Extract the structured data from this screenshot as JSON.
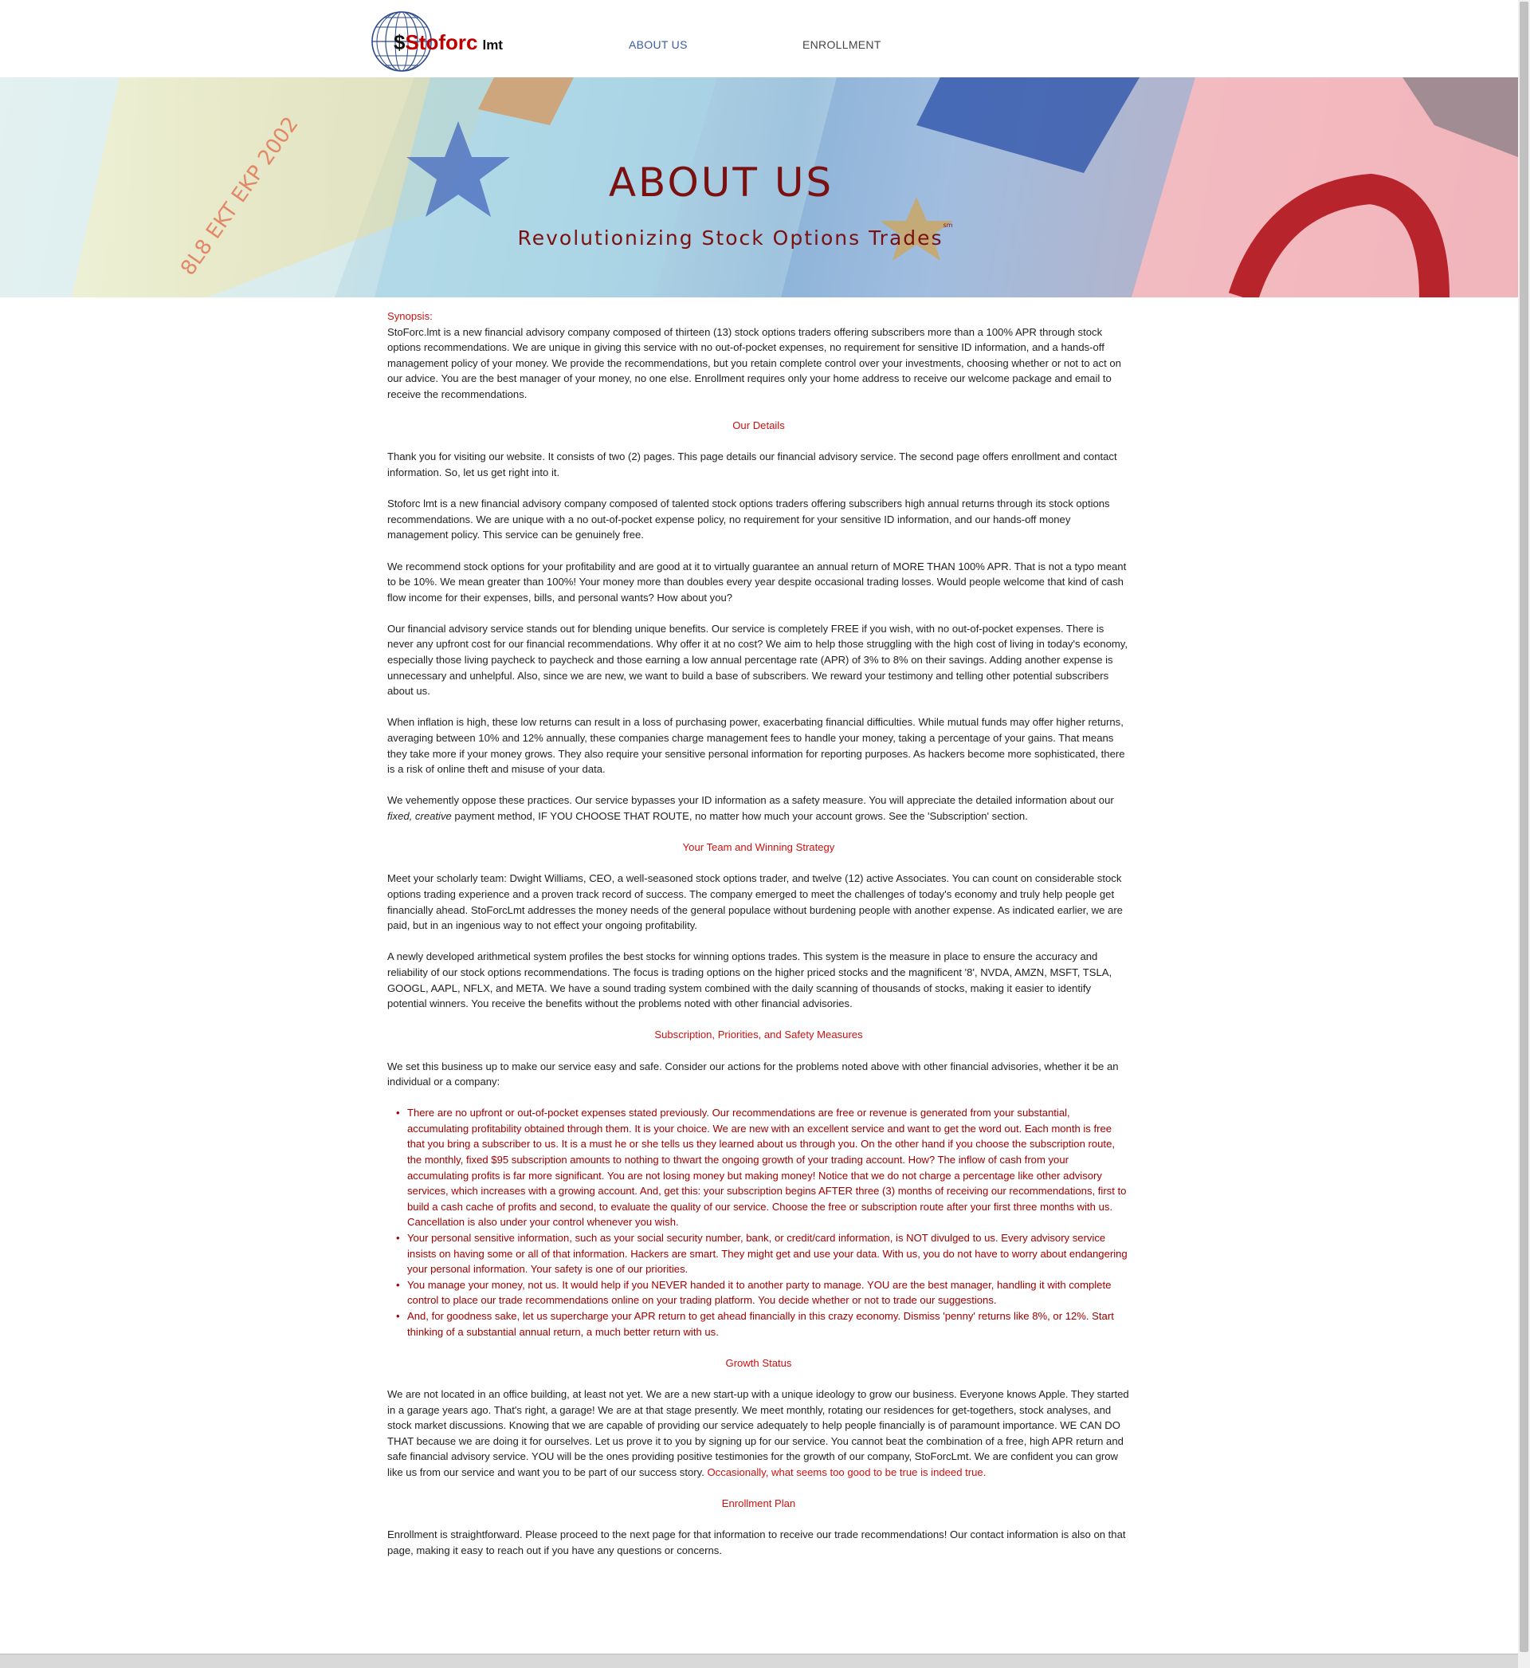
{
  "header": {
    "logo": {
      "dollar": "$",
      "brand": "Stoforc",
      "suffix": "lmt"
    },
    "nav": {
      "about": "ABOUT US",
      "enrollment": "ENROLLMENT"
    }
  },
  "banner": {
    "title": "ABOUT US",
    "subtitle": "Revolutionizing Stock Options Trades",
    "subtitle_mark": "sm"
  },
  "content": {
    "synopsis_label": "Synopsis:",
    "synopsis": "StoForc.lmt is a new financial advisory company composed of thirteen (13) stock options traders offering subscribers more than a 100% APR through stock options recommendations.  We are unique in giving this service with no out-of-pocket expenses, no requirement for sensitive ID information, and a hands-off management policy of your money. We provide the recommendations, but you retain complete control over your investments, choosing whether or not to act on our advice. You are the best manager of your money, no one else. Enrollment requires only your home address to receive our welcome package and email to receive the recommendations.",
    "details_heading": "Our Details",
    "details_p1": "Thank you for visiting our website. It consists of two (2) pages. This page details our financial advisory service. The second page offers enrollment and contact information. So, let us get right into it.",
    "details_p2": "Stoforc lmt is a new financial advisory company composed of talented stock options traders offering subscribers high annual returns through its stock options recommendations.  We are unique with a no out-of-pocket expense policy, no requirement for your sensitive ID information, and our hands-off money management policy. This service can be genuinely free.",
    "details_p3": "We recommend stock options for your profitability and are good at it to virtually guarantee an annual return of MORE THAN 100% APR. That is not a typo meant to be 10%. We mean greater than 100%! Your money more than doubles every year despite occasional trading losses. Would people welcome that kind of cash flow income for their expenses, bills, and personal wants? How about you?",
    "details_p4": "Our financial advisory service stands out for blending unique benefits. Our service is completely FREE if you wish, with no out-of-pocket expenses. There is never any upfront cost for our financial recommendations. Why offer it at no cost? We aim to help those struggling with the high cost of living in today's economy, especially those living paycheck to paycheck and those earning a low annual percentage rate (APR) of 3% to 8% on their savings. Adding another expense is unnecessary and unhelpful. Also, since we are new, we want to build a base of subscribers. We reward your testimony and telling other potential subscribers about us.",
    "details_p5": "When inflation is high, these low returns can result in a loss of purchasing power, exacerbating financial difficulties. While mutual funds may offer higher returns, averaging between 10% and 12% annually, these companies charge management fees to handle your money, taking a percentage of your gains. That means they take more if your money grows. They also require your sensitive personal information for reporting purposes. As hackers become more sophisticated, there is a risk of online theft and misuse of your data.",
    "details_p6_a": "We vehemently oppose these practices. Our service bypasses your ID information as a safety measure. You will appreciate the detailed information about our ",
    "details_p6_fixed": "fixed, creative",
    "details_p6_b": " payment method, IF YOU CHOOSE THAT ROUTE, no matter how much your account grows. See the 'Subscription' section.",
    "team_heading": "Your Team and Winning Strategy",
    "team_p1": "Meet your scholarly team: Dwight Williams, CEO, a well-seasoned stock options trader, and twelve (12) active Associates. You can count on considerable stock options trading experience and a proven track record of success. The company emerged to meet the challenges of today's economy and truly help people get financially ahead. StoForcLmt addresses the money needs of the general populace without burdening people with another expense. As indicated earlier, we are paid, but in an ingenious way to not effect your ongoing profitability.",
    "team_p2": "A newly developed arithmetical system profiles the best stocks for winning options trades. This system is the measure in place to ensure the accuracy and reliability of our stock options recommendations. The focus is trading options on the higher priced stocks and the magnificent '8', NVDA, AMZN, MSFT, TSLA, GOOGL, AAPL, NFLX, and META. We have a sound trading system combined with the daily scanning of thousands of stocks, making it easier to identify potential winners. You receive the benefits without the problems noted with other financial advisories.",
    "subs_heading": "Subscription, Priorities, and Safety Measures",
    "subs_p1": "We set this business up to make our service easy and safe. Consider our actions for the problems noted above with other financial advisories, whether it be an individual or a company:",
    "bullets": [
      "There are no upfront or out-of-pocket expenses stated previously. Our  recommendations are free or revenue is generated from your substantial, accumulating profitability obtained through them. It is your choice. We are new with an excellent service and want to get the word out. Each month is free that you bring a subscriber to us. It is a must he or she tells us they learned about us through you. On the other hand if you choose the subscription route, the monthly, fixed $95 subscription amounts to nothing to thwart the ongoing growth of your trading account. How? The inflow of cash from your accumulating profits is far more significant. You are not losing money but making money! Notice that we do not charge a percentage like other advisory services, which increases with a growing account. And, get this: your subscription begins AFTER three (3) months of receiving our recommendations, first to build a cash cache of profits and second, to evaluate the quality of our service. Choose the free or subscription route after your first three months with us. Cancellation is also under your control whenever you wish.",
      "Your personal sensitive information, such as your social security number, bank, or credit/card information, is NOT divulged to us. Every advisory service insists on having some or all of that information. Hackers are smart. They might get and use your data. With us, you do not have to worry about endangering your personal information. Your safety is one of our priorities.",
      "You manage your money, not us. It would help if you NEVER handed it to another party to manage. YOU are the best manager, handling it with complete control to place our trade recommendations online on your trading platform. You decide whether or not to trade our suggestions.",
      "And, for goodness sake, let us supercharge your APR return to get ahead financially in this crazy economy.  Dismiss 'penny' returns like 8%, or 12%. Start thinking of a substantial annual return, a much better return with us."
    ],
    "growth_heading": "Growth Status",
    "growth_p1_a": "We are not located in an office building, at least not yet. We are a new start-up with a unique ideology to grow our business. Everyone knows Apple. They started in a garage years ago. That's right, a garage! We are at that stage presently. We meet monthly, rotating our residences for get-togethers, stock analyses, and stock market discussions. Knowing that we are capable of providing our service adequately to help people financially is of paramount importance.  WE CAN DO THAT because we are doing it for ourselves. Let us prove it to you by signing up for our service. You cannot beat the combination of a free, high APR return and safe financial advisory service. YOU will be the ones providing positive testimonies for the growth of our company, StoForcLmt. We are confident you can grow like us from our service and want you to be part of our success story. ",
    "growth_p1_red": "Occasionally, what seems too good to be true is indeed true.",
    "enroll_heading": "Enrollment Plan",
    "enroll_p1": "Enrollment is straightforward. Please proceed to the next page for that information to receive our trade recommendations! Our contact information is also on that page, making it easy to reach out if you have any questions or concerns."
  },
  "colors": {
    "heading_red": "#cc1111",
    "bullet_red": "#a00000",
    "banner_text": "#7a1010",
    "nav_active": "#3b5aa8"
  }
}
